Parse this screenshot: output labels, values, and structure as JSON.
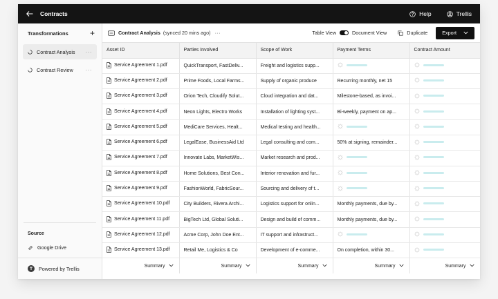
{
  "topbar": {
    "title": "Contracts",
    "help_label": "Help",
    "user_label": "Trellis"
  },
  "sidebar": {
    "heading": "Transformations",
    "items": [
      {
        "label": "Contract Analysis",
        "active": true
      },
      {
        "label": "Contract Review",
        "active": false
      }
    ],
    "source_heading": "Source",
    "source_item": "Google Drive",
    "powered_by": "Powered by Trellis"
  },
  "toolbar": {
    "doc_name": "Contract Analysis",
    "sync_status": "(synced 20 mins ago)",
    "table_view_label": "Table View",
    "document_view_label": "Document View",
    "duplicate_label": "Duplicate",
    "export_label": "Export"
  },
  "table": {
    "columns": [
      "Asset ID",
      "Parties Involved",
      "Scope of Work",
      "Payment Terms",
      "Contract Amount"
    ],
    "rows": [
      {
        "asset": "Service Agreement 1.pdf",
        "parties": "QuickTransport, FastDeliv...",
        "scope": "Freight and logistics supp...",
        "payment": null,
        "amount": null
      },
      {
        "asset": "Service Agreement 2.pdf",
        "parties": "Prime Foods, Local Farms...",
        "scope": "Supply of organic produce",
        "payment": "Recurring monthly, net 15",
        "amount": null
      },
      {
        "asset": "Service Agreement 3.pdf",
        "parties": "Orion Tech, Cloudify Solut...",
        "scope": "Cloud integration and dat...",
        "payment": "Milestone-based, as invoi...",
        "amount": null
      },
      {
        "asset": "Service Agreement 4.pdf",
        "parties": "Neon Lights, Electro Works",
        "scope": "Installation of lighting syst...",
        "payment": "Bi-weekly, payment on ap...",
        "amount": null
      },
      {
        "asset": "Service Agreement 5.pdf",
        "parties": "MediCare Services, Healt...",
        "scope": "Medical testing and health...",
        "payment": null,
        "amount": null
      },
      {
        "asset": "Service Agreement 6.pdf",
        "parties": "LegalEase, BusinessAid Ltd",
        "scope": "Legal consulting and com...",
        "payment": "50% at signing, remainder...",
        "amount": null
      },
      {
        "asset": "Service Agreement 7.pdf",
        "parties": "Innovate Labs, MarketWis...",
        "scope": "Market research and prod...",
        "payment": null,
        "amount": null
      },
      {
        "asset": "Service Agreement 8.pdf",
        "parties": "Home Solutions, Best Con...",
        "scope": "Interior renovation and fur...",
        "payment": null,
        "amount": null
      },
      {
        "asset": "Service Agreement 9.pdf",
        "parties": "FashionWorld, FabricSour...",
        "scope": "Sourcing and delivery of t...",
        "payment": null,
        "amount": null
      },
      {
        "asset": "Service Agreement 10.pdf",
        "parties": "City Builders, Rivera Archi...",
        "scope": "Logistics support for onlin...",
        "payment": "Monthly payments, due by...",
        "amount": null
      },
      {
        "asset": "Service Agreement 11.pdf",
        "parties": "BigTech Ltd, Global Soluti...",
        "scope": "Design and build of comm...",
        "payment": "Monthly payments, due by...",
        "amount": null
      },
      {
        "asset": "Service Agreement 12.pdf",
        "parties": "Acme Corp, John Doe Ent...",
        "scope": "IT support and infrastruct...",
        "payment": null,
        "amount": null
      },
      {
        "asset": "Service Agreement 13.pdf",
        "parties": "Retail Me, Logistics & Co",
        "scope": "Development of e-comme...",
        "payment": "On completion, within 30...",
        "amount": null
      }
    ],
    "summary_label": "Summary"
  },
  "colors": {
    "topbar_bg": "#141414",
    "loading_bar": "#c9ecee",
    "export_bg": "#111111"
  }
}
